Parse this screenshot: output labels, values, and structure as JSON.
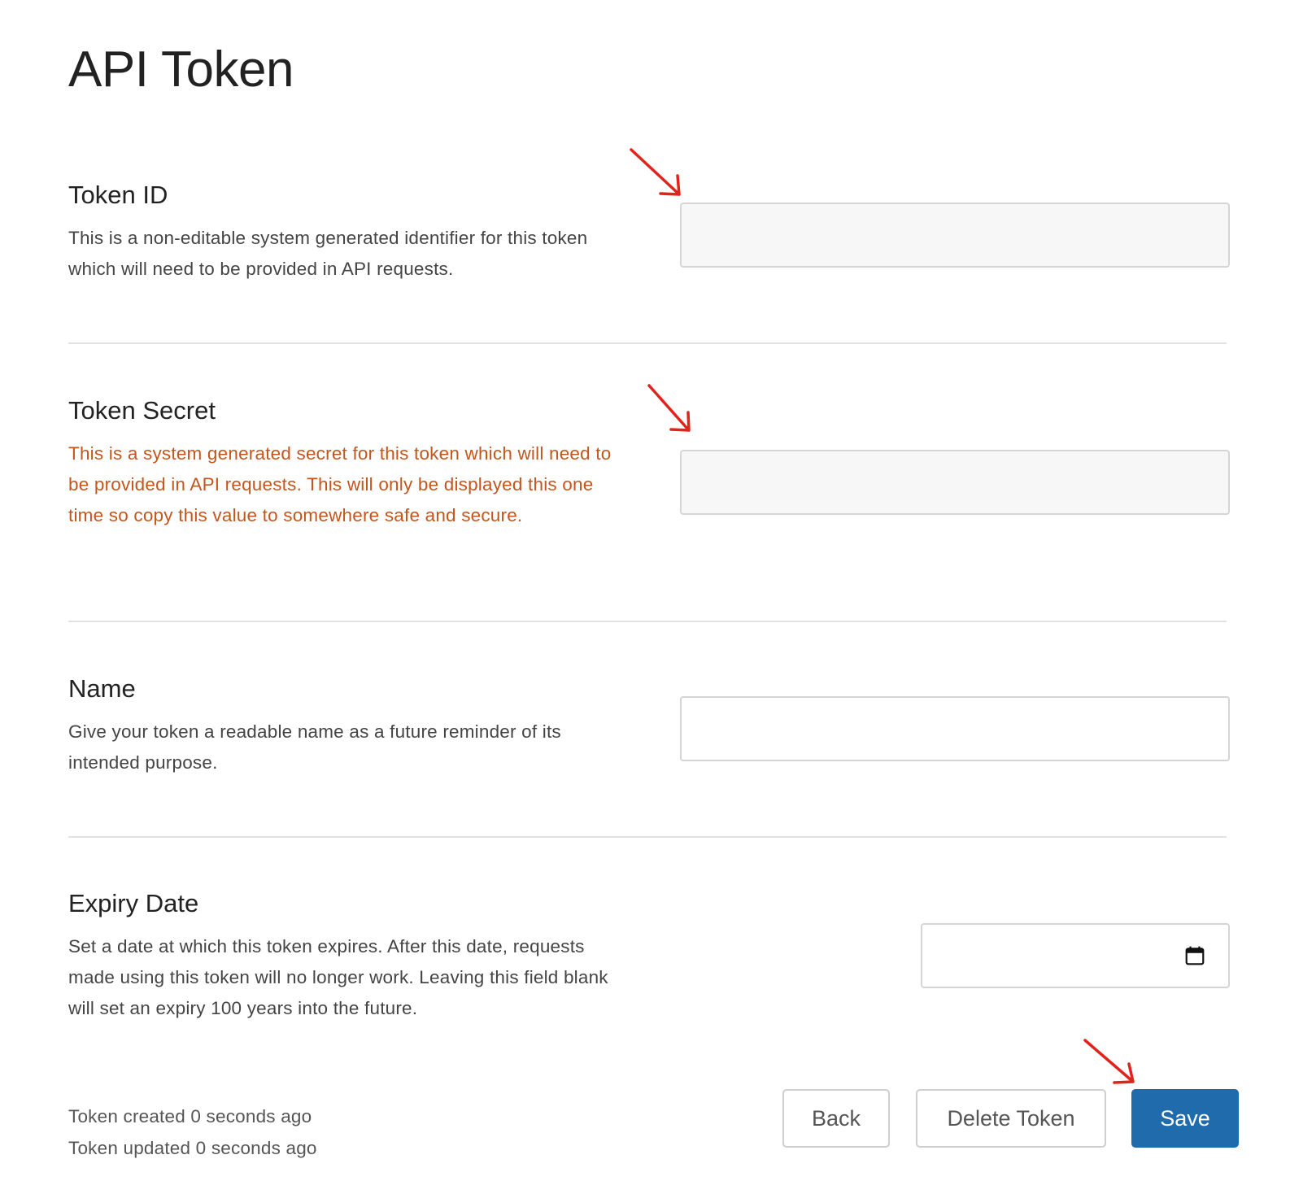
{
  "page": {
    "title": "API Token"
  },
  "sections": {
    "token_id": {
      "title": "Token ID",
      "description": "This is a non-editable system generated identifier for this token which will need to be provided in API requests.",
      "value": ""
    },
    "token_secret": {
      "title": "Token Secret",
      "description": "This is a system generated secret for this token which will need to be provided in API requests. This will only be displayed this one time so copy this value to somewhere safe and secure.",
      "value": ""
    },
    "name": {
      "title": "Name",
      "description": "Give your token a readable name as a future reminder of its intended purpose.",
      "value": ""
    },
    "expiry_date": {
      "title": "Expiry Date",
      "description": "Set a date at which this token expires. After this date, requests made using this token will no longer work. Leaving this field blank will set an expiry 100 years into the future.",
      "value": "",
      "icon": "calendar-icon"
    }
  },
  "footer": {
    "created": "Token created 0 seconds ago",
    "updated": "Token updated 0 seconds ago",
    "back_label": "Back",
    "delete_label": "Delete Token",
    "save_label": "Save"
  },
  "annotations": {
    "arrow_color": "#e0241b",
    "arrow_icon": "arrow-down-right-icon"
  },
  "colors": {
    "warning_text": "#c4561d",
    "primary_button": "#206bab"
  }
}
